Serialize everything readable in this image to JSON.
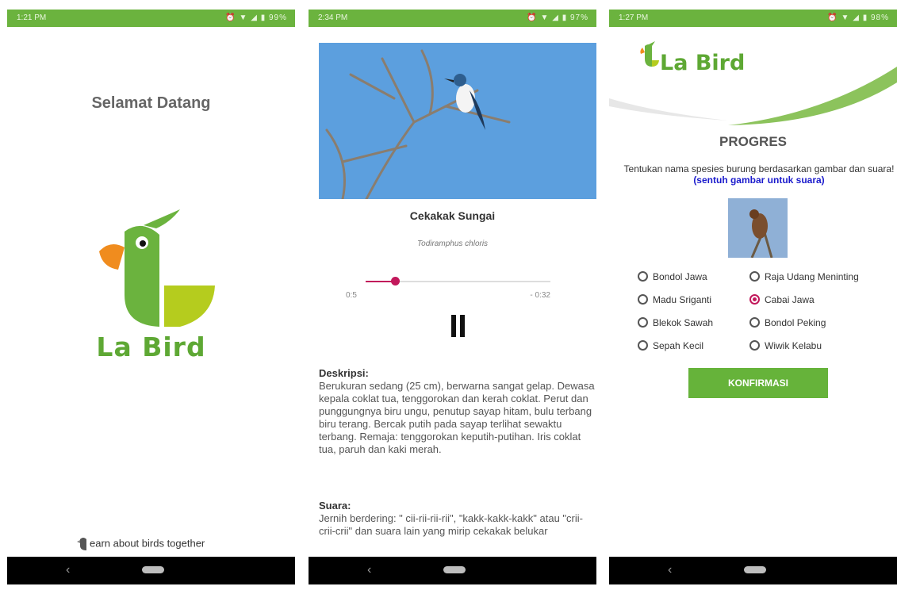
{
  "screen1": {
    "status": {
      "time": "1:21 PM",
      "icons": "⏰ ▼ ◢ ▮ 99%"
    },
    "welcome": "Selamat Datang",
    "brand": "La Bird",
    "tagline": "earn about birds together"
  },
  "screen2": {
    "status": {
      "time": "2:34 PM",
      "icons": "⏰ ▼ ◢ ▮ 97%"
    },
    "species_name": "Cekakak Sungai",
    "scientific_name": "Todiramphus chloris",
    "player": {
      "current": "0:5",
      "remaining": "- 0:32",
      "progress": 0.16
    },
    "description_heading": "Deskripsi:",
    "description": "Berukuran sedang (25 cm), berwarna sangat gelap. Dewasa kepala coklat tua, tenggorokan dan kerah coklat. Perut dan punggungnya biru ungu, penutup sayap hitam, bulu terbang biru terang. Bercak putih pada sayap terlihat sewaktu terbang. Remaja: tenggorokan keputih-putihan. Iris coklat tua, paruh dan kaki merah.",
    "sound_heading": "Suara:",
    "sound": "Jernih berdering: \" cii-rii-rii-rii\", \"kakk-kakk-kakk\" atau \"crii-crii-crii\" dan suara lain yang mirip cekakak belukar"
  },
  "screen3": {
    "status": {
      "time": "1:27 PM",
      "icons": "⏰ ▼ ◢ ▮ 98%"
    },
    "brand": "La Bird",
    "title": "PROGRES",
    "instruction": "Tentukan nama spesies burung berdasarkan gambar dan suara!",
    "instruction_hint": "(sentuh gambar untuk suara)",
    "options_left": [
      "Bondol Jawa",
      "Madu Sriganti",
      "Blekok Sawah",
      "Sepah Kecil"
    ],
    "options_right": [
      "Raja Udang Meninting",
      "Cabai Jawa",
      "Bondol Peking",
      "Wiwik Kelabu"
    ],
    "selected": "Cabai Jawa",
    "confirm_label": "KONFIRMASI"
  },
  "colors": {
    "brand_green": "#6bb33e",
    "accent_pink": "#c2185b",
    "hint_blue": "#1a1acc"
  },
  "icons": [
    "back-icon",
    "home-icon",
    "alarm-icon",
    "wifi-icon",
    "signal-icon",
    "battery-icon",
    "pause-icon",
    "bird-logo-icon"
  ]
}
